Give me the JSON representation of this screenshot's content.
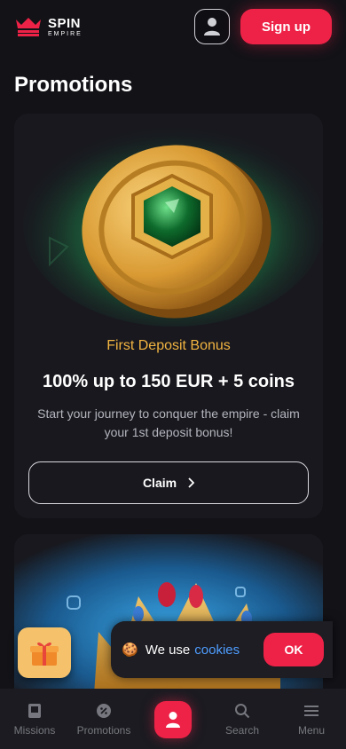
{
  "header": {
    "logo_line1": "SPIN",
    "logo_line2": "EMPIRE",
    "signup_label": "Sign up"
  },
  "page_title": "Promotions",
  "promo": {
    "subtitle": "First Deposit Bonus",
    "title": "100% up to 150 EUR + 5 coins",
    "description": "Start your journey to conquer the empire - claim your 1st deposit bonus!",
    "claim_label": "Claim"
  },
  "cookie": {
    "text": "We use",
    "link": "cookies",
    "ok_label": "OK"
  },
  "nav": {
    "missions": "Missions",
    "promotions": "Promotions",
    "search": "Search",
    "menu": "Menu"
  },
  "colors": {
    "accent": "#ee2247",
    "gold_text": "#f2b441",
    "background": "#121217",
    "card": "#18181e"
  },
  "icons": [
    "crown-logo-icon",
    "user-icon",
    "chevron-right-icon",
    "gift-icon",
    "cookie-icon",
    "book-icon",
    "tag-icon",
    "search-icon",
    "menu-icon"
  ]
}
